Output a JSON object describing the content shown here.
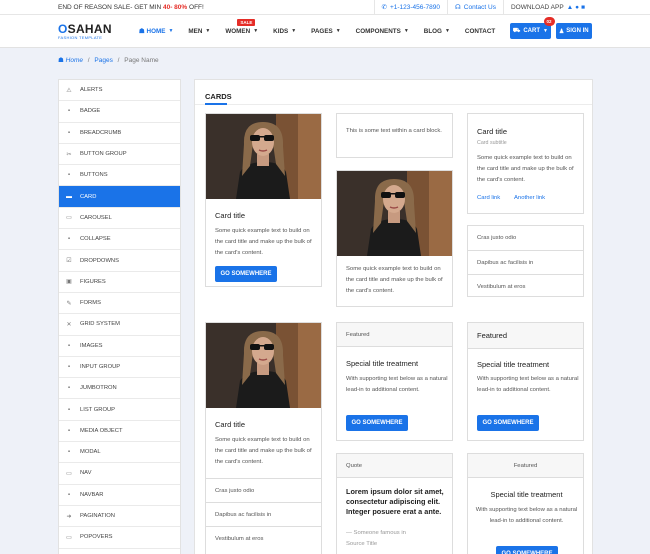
{
  "topbar": {
    "promo_text": "END OF REASON SALE- GET MIN ",
    "promo_highlight": "40- 80%",
    "promo_suffix": " OFF!",
    "phone": "+1-123-456-7890",
    "contact": "Contact Us",
    "download": "DOWNLOAD APP"
  },
  "header": {
    "brand": "SAHAN",
    "brand_o": "O",
    "subtitle": "FASHION TEMPLATE",
    "sale_badge": "SALE",
    "cart_label": "CART",
    "cart_count": "02",
    "signin": "SIGN IN"
  },
  "nav": [
    "HOME",
    "MEN",
    "WOMEN",
    "KIDS",
    "PAGES",
    "COMPONENTS",
    "BLOG",
    "CONTACT"
  ],
  "breadcrumb": {
    "home": "Home",
    "pages": "Pages",
    "current": "Page Name",
    "sep": "/"
  },
  "sidebar": [
    {
      "label": "ALERTS",
      "icon": "alert-icon",
      "glyph": "⚠"
    },
    {
      "label": "BADGE",
      "icon": "badge-icon",
      "glyph": "▪"
    },
    {
      "label": "BREADCRUMB",
      "icon": "breadcrumb-icon",
      "glyph": "▪"
    },
    {
      "label": "BUTTON GROUP",
      "icon": "button-group-icon",
      "glyph": "✂"
    },
    {
      "label": "BUTTONS",
      "icon": "buttons-icon",
      "glyph": "▪"
    },
    {
      "label": "CARD",
      "icon": "card-icon",
      "glyph": "▬",
      "active": true
    },
    {
      "label": "CAROUSEL",
      "icon": "carousel-icon",
      "glyph": "▭"
    },
    {
      "label": "COLLAPSE",
      "icon": "collapse-icon",
      "glyph": "▪"
    },
    {
      "label": "DROPDOWNS",
      "icon": "dropdowns-icon",
      "glyph": "☑"
    },
    {
      "label": "FIGURES",
      "icon": "figures-icon",
      "glyph": "▣"
    },
    {
      "label": "FORMS",
      "icon": "forms-icon",
      "glyph": "✎"
    },
    {
      "label": "GRID SYSTEM",
      "icon": "grid-system-icon",
      "glyph": "✕"
    },
    {
      "label": "IMAGES",
      "icon": "images-icon",
      "glyph": "▪"
    },
    {
      "label": "INPUT GROUP",
      "icon": "input-group-icon",
      "glyph": "▪"
    },
    {
      "label": "JUMBOTRON",
      "icon": "jumbotron-icon",
      "glyph": "▪"
    },
    {
      "label": "LIST GROUP",
      "icon": "list-group-icon",
      "glyph": "▪"
    },
    {
      "label": "MEDIA OBJECT",
      "icon": "media-object-icon",
      "glyph": "▪"
    },
    {
      "label": "MODAL",
      "icon": "modal-icon",
      "glyph": "▪"
    },
    {
      "label": "NAV",
      "icon": "nav-icon",
      "glyph": "▭"
    },
    {
      "label": "NAVBAR",
      "icon": "navbar-icon",
      "glyph": "▪"
    },
    {
      "label": "PAGINATION",
      "icon": "pagination-icon",
      "glyph": "➜"
    },
    {
      "label": "POPOVERS",
      "icon": "popovers-icon",
      "glyph": "▭"
    }
  ],
  "section_title": "CARDS",
  "cards": {
    "title": "Card title",
    "text": "Some quick example text to build on the card title and make up the bulk of the card's content.",
    "button": "GO SOMEWHERE",
    "within": "This is some text within a card block.",
    "subtitle": "Card subtitle",
    "link1": "Card link",
    "link2": "Another link",
    "list": [
      "Cras justo odio",
      "Dapibus ac facilisis in",
      "Vestibulum at eros"
    ],
    "featured": "Featured",
    "special_title": "Special title treatment",
    "special_text": "With supporting text below as a natural lead-in to additional content.",
    "quote_header": "Quote",
    "quote_text": "Lorem ipsum dolor sit amet, consectetur adipiscing elit. Integer posuere erat a ante.",
    "quote_footer": "— Someone famous in",
    "quote_source": "Source Title"
  },
  "colors": {
    "accent": "#1a73e8",
    "sale": "#e52d27"
  }
}
